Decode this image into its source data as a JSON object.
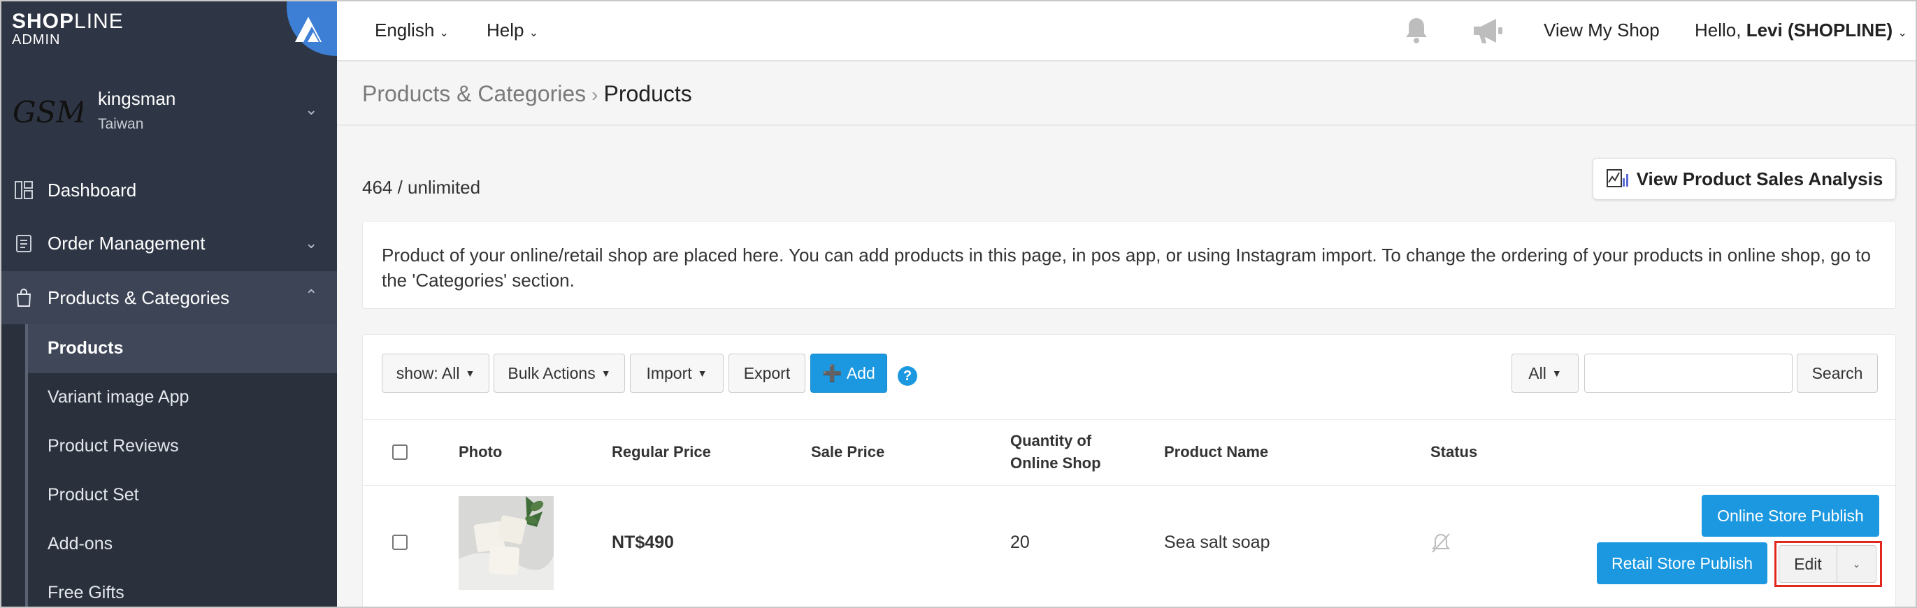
{
  "brand": {
    "logo_bold": "SHOP",
    "logo_thin": "LINE",
    "sub": "ADMIN"
  },
  "store": {
    "avatar_text": "GSM",
    "name": "kingsman",
    "region": "Taiwan"
  },
  "nav": {
    "dashboard": "Dashboard",
    "orders": "Order Management",
    "products": "Products & Categories",
    "sub": [
      "Products",
      "Variant image App",
      "Product Reviews",
      "Product Set",
      "Add-ons",
      "Free Gifts"
    ]
  },
  "topbar": {
    "language": "English",
    "help": "Help",
    "view_shop": "View My Shop",
    "greeting": "Hello, ",
    "user": "Levi (SHOPLINE)"
  },
  "breadcrumb": {
    "parent": "Products & Categories",
    "current": "Products"
  },
  "count_text": "464 / unlimited",
  "analysis_button": "View Product Sales Analysis",
  "info_text": "Product of your online/retail shop are placed here. You can add products in this page, in pos app, or using Instagram import. To change the ordering of your products in online shop, go to the 'Categories' section.",
  "toolbar": {
    "show": "show: All",
    "bulk": "Bulk Actions",
    "import": "Import",
    "export": "Export",
    "add": "Add",
    "filter": "All",
    "search": "Search",
    "search_value": ""
  },
  "table": {
    "headers": {
      "photo": "Photo",
      "regular_price": "Regular Price",
      "sale_price": "Sale Price",
      "qty_line1": "Quantity of",
      "qty_line2": "Online Shop",
      "name": "Product Name",
      "status": "Status"
    },
    "rows": [
      {
        "regular_price": "NT$490",
        "sale_price": "",
        "quantity": "20",
        "name": "Sea salt soap",
        "status_icon": "notification-off-icon",
        "online_publish": "Online Store Publish",
        "retail_publish": "Retail Store Publish",
        "edit": "Edit"
      }
    ]
  },
  "colors": {
    "sidebar": "#2e3544",
    "accent": "#1b98e0",
    "highlight": "#e0281c"
  }
}
